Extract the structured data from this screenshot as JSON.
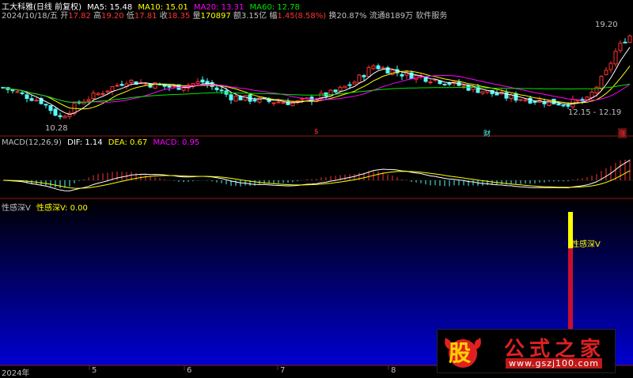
{
  "colors": {
    "up": "#ff3232",
    "down": "#54fcfc",
    "ma5": "#ffffff",
    "ma10": "#ffff00",
    "ma20": "#ff00ff",
    "ma60": "#00e600",
    "label_gray": "#c0c0c0",
    "divider": "#8b1a1a"
  },
  "main_header": {
    "stock": "工大科雅(日线 前复权)",
    "ma5": "MA5: 15.48",
    "ma10": "MA10: 15.01",
    "ma20": "MA20: 13.31",
    "ma60": "MA60: 12.78"
  },
  "info_bar": {
    "date": "2024/10/18/五",
    "open_label": "开",
    "open": "17.82",
    "high_label": "高",
    "high": "19.20",
    "low_label": "低",
    "low": "17.81",
    "close_label": "收",
    "close": "18.35",
    "vol_label": "量",
    "vol": "170897",
    "amt_label": "额",
    "amt": "3.15亿",
    "chg_label": "幅",
    "chg": "1.45(8.58%)",
    "turn": "换20.87%",
    "float": "流通8189万",
    "industry": "软件服务"
  },
  "price_labels": {
    "high": "19.20",
    "low": "10.28",
    "range": "12.15 - 12.19"
  },
  "markers": {
    "m1": "$",
    "m2": "财",
    "m3": "涨"
  },
  "macd_header": {
    "name": "MACD(12,26,9)",
    "dif": "DIF: 1.14",
    "dea": "DEA: 0.67",
    "macd": "MACD: 0.95"
  },
  "ind_header": {
    "name": "性感深V",
    "value": "性感深V: 0.00"
  },
  "ind_label": "性感深V",
  "x_axis": [
    "2024年",
    "5",
    "6",
    "7",
    "8"
  ],
  "watermark": {
    "logo": "股",
    "name": "公式之家",
    "url": "www.gszj100.com"
  },
  "chart_data": [
    {
      "type": "candlestick",
      "title": "工大科雅(日线 前复权)",
      "price_range": [
        10.28,
        19.2
      ],
      "series": [
        {
          "name": "MA5",
          "values": [
            15.48
          ]
        },
        {
          "name": "MA10",
          "values": [
            15.01
          ]
        },
        {
          "name": "MA20",
          "values": [
            13.31
          ]
        },
        {
          "name": "MA60",
          "values": [
            12.78
          ]
        }
      ]
    },
    {
      "type": "bar",
      "title": "MACD(12,26,9)",
      "series": [
        {
          "name": "DIF",
          "values": [
            1.14
          ]
        },
        {
          "name": "DEA",
          "values": [
            0.67
          ]
        },
        {
          "name": "MACD",
          "values": [
            0.95
          ]
        }
      ]
    },
    {
      "type": "bar",
      "title": "性感深V",
      "series": [
        {
          "name": "性感深V",
          "values": [
            0.0
          ]
        }
      ]
    }
  ]
}
